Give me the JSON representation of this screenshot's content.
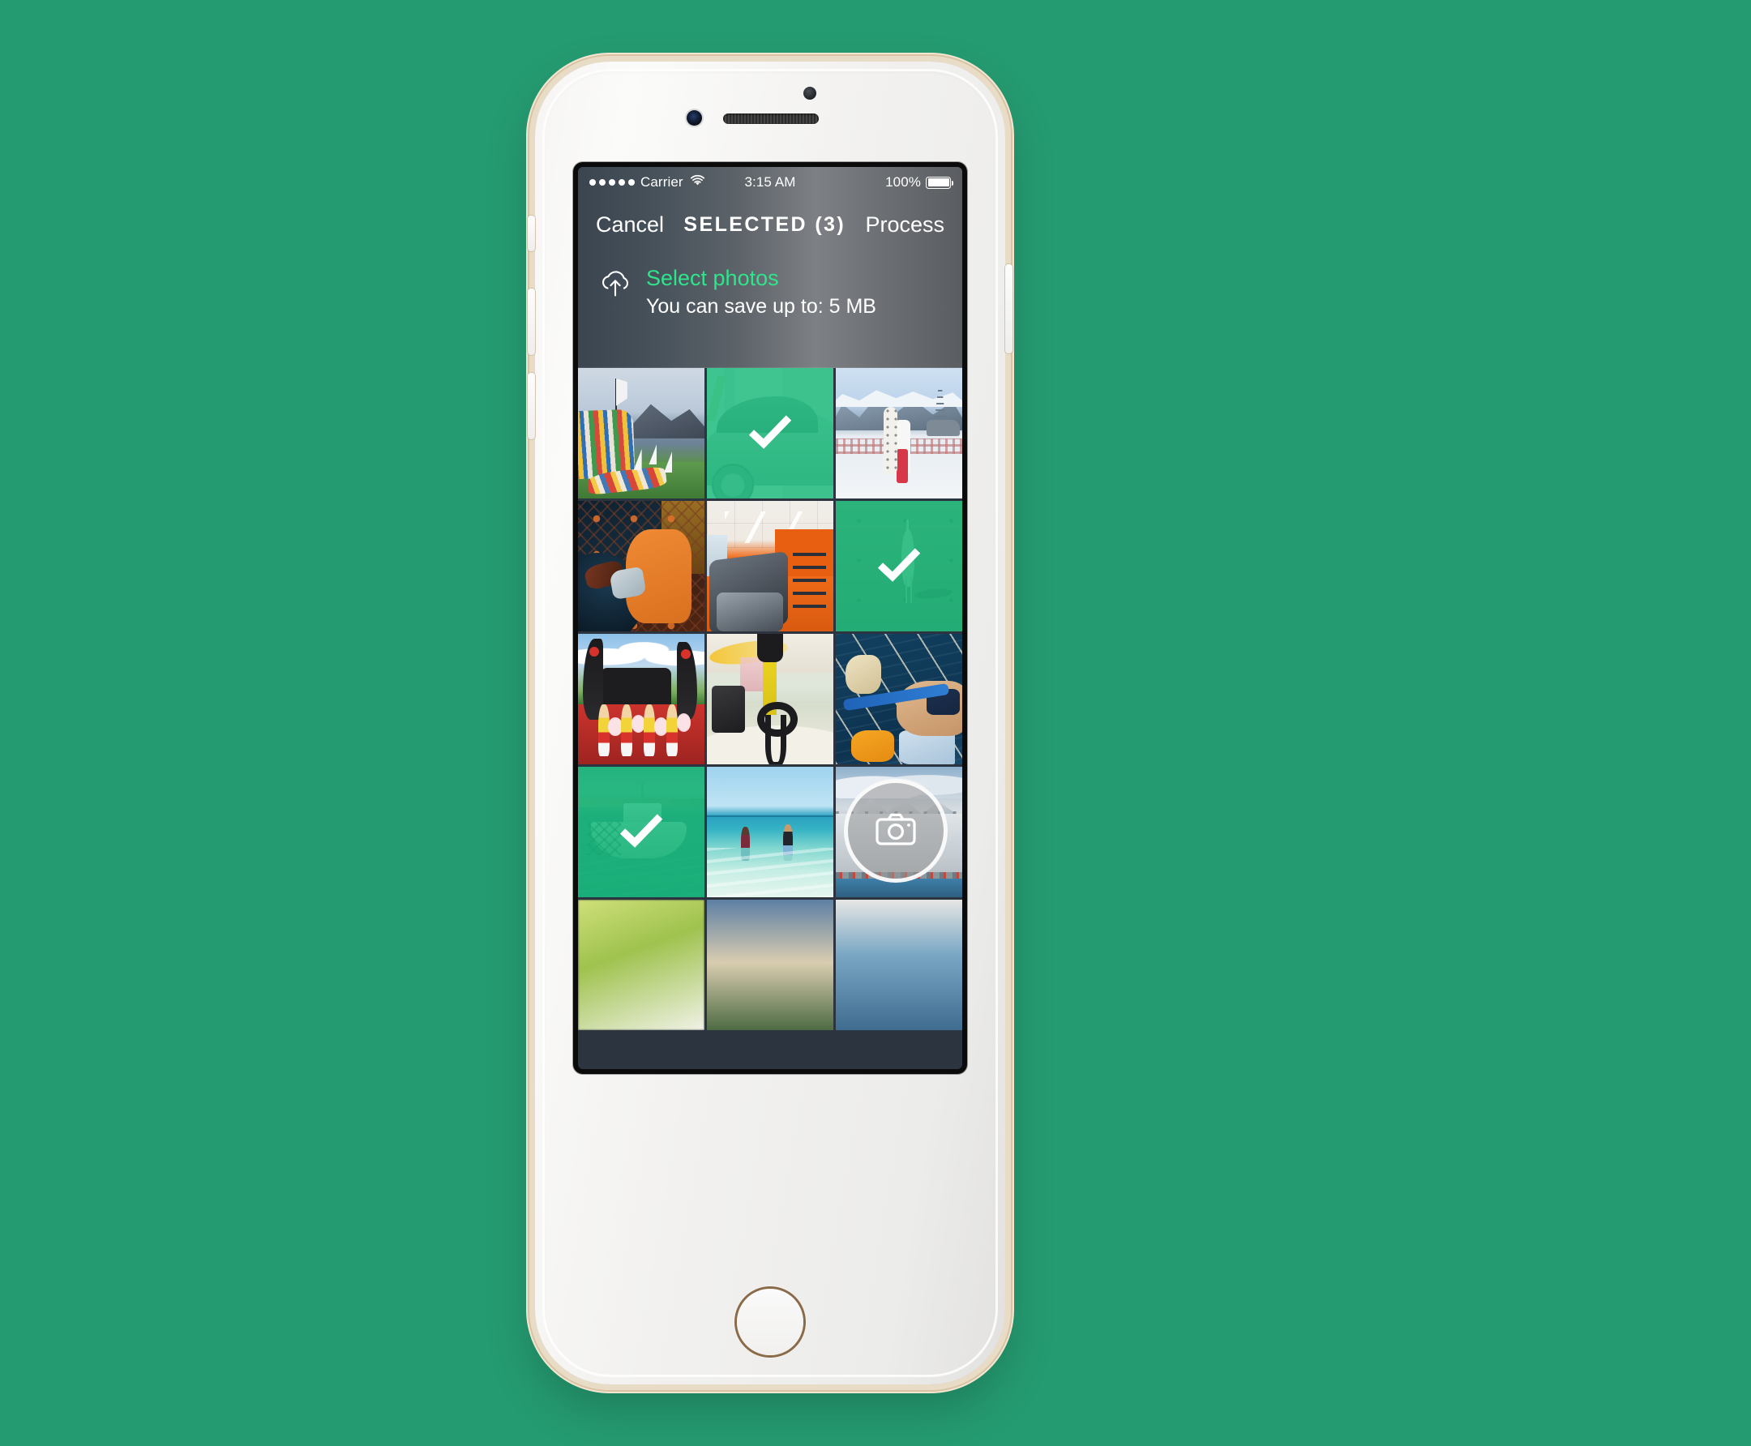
{
  "theme": {
    "backdrop_color": "#259b71",
    "accent_green": "#2ee58b",
    "selection_overlay": "#0fb877",
    "selection_border": "#2fe58f",
    "nav_text_color": "#ffffff"
  },
  "device": {
    "name": "iphone-6s-gold",
    "frame_color": "#e9dcc7",
    "body_color": "#f4f3f1"
  },
  "status_bar": {
    "signal_dots": 5,
    "carrier": "Carrier",
    "wifi_icon": "wifi-icon",
    "time": "3:15 AM",
    "battery_percent": "100%",
    "battery_icon": "battery-full-icon"
  },
  "nav_bar": {
    "cancel_label": "Cancel",
    "title": "SELECTED (3)",
    "process_label": "Process"
  },
  "info_panel": {
    "cloud_icon": "cloud-upload-icon",
    "title": "Select photos",
    "subtitle": "You can save up to: 5 MB"
  },
  "camera_button": {
    "icon": "camera-icon",
    "label": ""
  },
  "grid": {
    "columns": 3,
    "selected_count": 3,
    "cells": [
      {
        "id": "photo-1",
        "alt": "windsurf boards on lakeshore with mountains",
        "selected": false,
        "art": "a1"
      },
      {
        "id": "photo-2",
        "alt": "white car in showroom",
        "selected": true,
        "art": "a2"
      },
      {
        "id": "photo-3",
        "alt": "snowboarder walking on snow",
        "selected": false,
        "art": "a3"
      },
      {
        "id": "photo-4",
        "alt": "fisherman handling nets and catch",
        "selected": false,
        "art": "a4"
      },
      {
        "id": "photo-5",
        "alt": "orange gym with treadmills",
        "selected": false,
        "art": "a5"
      },
      {
        "id": "photo-6",
        "alt": "heron standing on sand",
        "selected": true,
        "art": "a6"
      },
      {
        "id": "photo-7",
        "alt": "ironman event cheerleaders on red carpet",
        "selected": false,
        "art": "a7"
      },
      {
        "id": "photo-8",
        "alt": "gym with trx straps and sled",
        "selected": false,
        "art": "a8"
      },
      {
        "id": "photo-9",
        "alt": "person on sailboat over blue water",
        "selected": false,
        "art": "a9"
      },
      {
        "id": "photo-10",
        "alt": "fishing boat with nets in turquoise water",
        "selected": true,
        "art": "a10"
      },
      {
        "id": "photo-11",
        "alt": "two people wading in tropical sea",
        "selected": false,
        "art": "a11"
      },
      {
        "id": "photo-12",
        "alt": "snowy mountain above lake",
        "selected": false,
        "art": "a12"
      },
      {
        "id": "photo-13",
        "alt": "blurred green field",
        "selected": false,
        "art": "a13"
      },
      {
        "id": "photo-14",
        "alt": "beach cliff with people",
        "selected": false,
        "art": "a14"
      },
      {
        "id": "photo-15",
        "alt": "harbour waterfront",
        "selected": false,
        "art": "a15"
      }
    ]
  }
}
